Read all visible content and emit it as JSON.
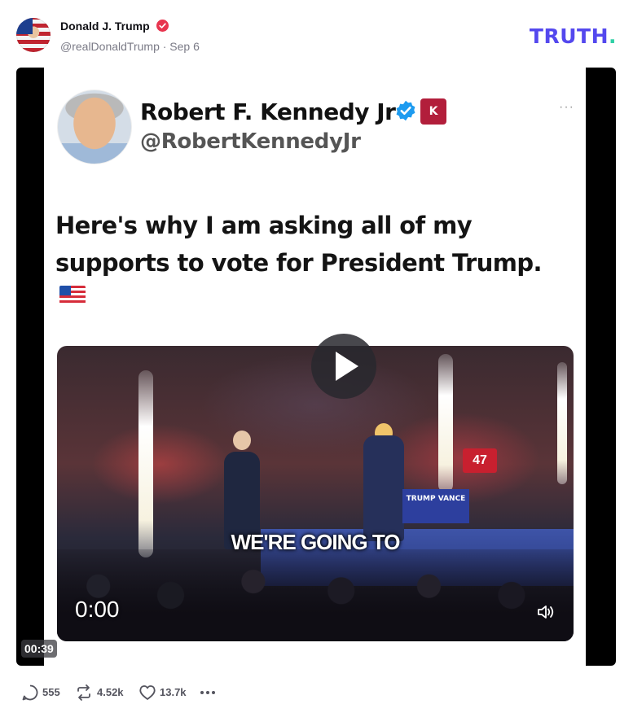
{
  "post": {
    "author_name": "Donald J. Trump",
    "handle_and_date": "@realDonaldTrump · Sep 6",
    "brand": "TRUTH",
    "brand_dot": "."
  },
  "embedded_tweet": {
    "name": "Robert F. Kennedy Jr",
    "handle": "@RobertKennedyJr",
    "badge": "K",
    "more": "···",
    "text_line1": "Here's why I am asking all of my",
    "text_line2": "supports to vote for President Trump."
  },
  "video": {
    "caption": "WE'RE GOING TO",
    "time_inner": "0:00",
    "duration": "00:39",
    "podium_text": "TRUMP VANCE",
    "sign_text": "47"
  },
  "actions": {
    "replies": "555",
    "retruths": "4.52k",
    "likes": "13.7k"
  },
  "colors": {
    "brand": "#5448ee",
    "brand_dot": "#2fd0a6",
    "verified_badge": "#e8354f",
    "tweet_verified": "#1d9bf0"
  }
}
